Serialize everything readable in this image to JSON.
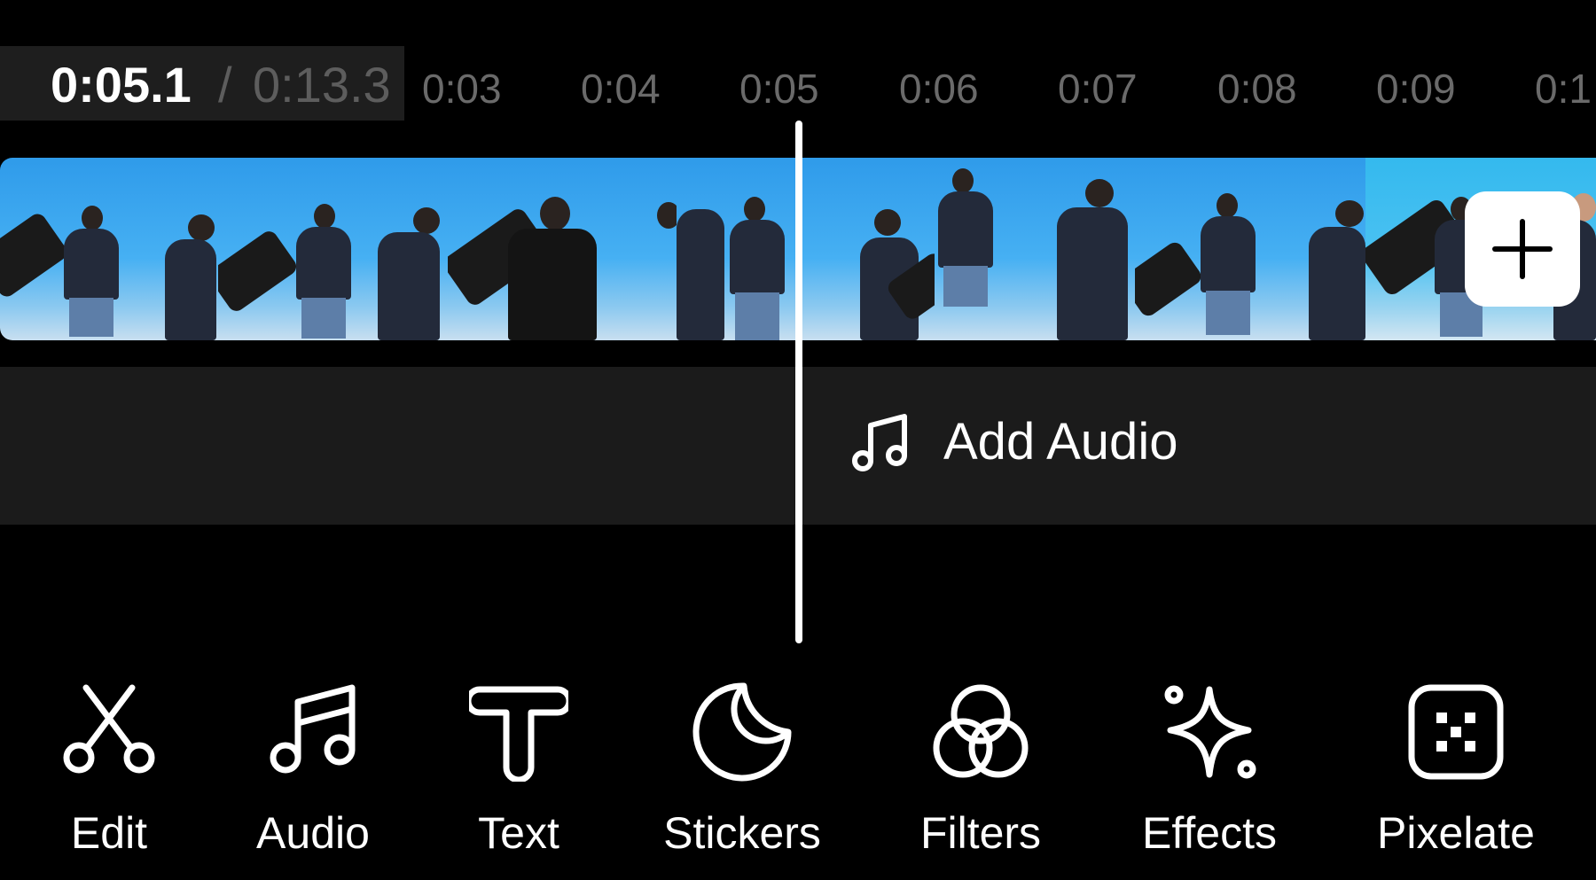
{
  "timeline": {
    "current_time": "0:05.1",
    "separator": "/",
    "total_time": "0:13.3",
    "ruler_labels": [
      "0:03",
      "0:04",
      "0:05",
      "0:06",
      "0:07",
      "0:08",
      "0:09",
      "0:1"
    ]
  },
  "audio_track": {
    "add_audio_label": "Add Audio",
    "icon": "music-note-icon"
  },
  "video_track": {
    "add_clip_icon": "plus-icon"
  },
  "toolbar": {
    "items": [
      {
        "label": "Edit",
        "icon": "scissors-icon"
      },
      {
        "label": "Audio",
        "icon": "music-note-icon"
      },
      {
        "label": "Text",
        "icon": "text-t-icon"
      },
      {
        "label": "Stickers",
        "icon": "sticker-icon"
      },
      {
        "label": "Filters",
        "icon": "filters-circles-icon"
      },
      {
        "label": "Effects",
        "icon": "sparkle-icon"
      },
      {
        "label": "Pixelate",
        "icon": "pixelate-icon"
      }
    ]
  },
  "colors": {
    "background": "#000000",
    "track_background": "#1b1b1b",
    "timecode_dim": "#5d5d5d",
    "ruler_text": "#6a6a6a",
    "video_sky": "#46b0f3"
  }
}
